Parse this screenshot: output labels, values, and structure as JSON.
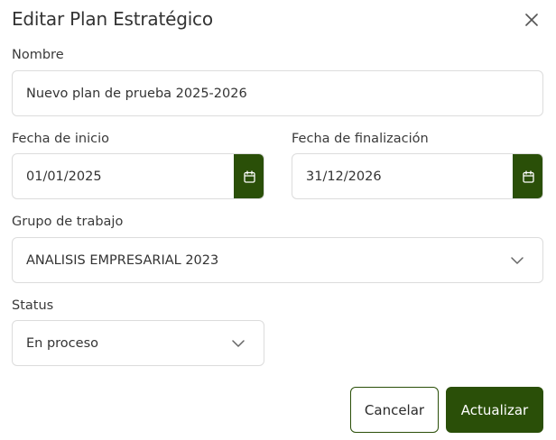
{
  "dialog": {
    "title": "Editar Plan Estratégico"
  },
  "form": {
    "name": {
      "label": "Nombre",
      "value": "Nuevo plan de prueba 2025-2026"
    },
    "start_date": {
      "label": "Fecha de inicio",
      "value": "01/01/2025"
    },
    "end_date": {
      "label": "Fecha de finalización",
      "value": "31/12/2026"
    },
    "work_group": {
      "label": "Grupo de trabajo",
      "value": "ANALISIS EMPRESARIAL 2023"
    },
    "status": {
      "label": "Status",
      "value": "En proceso"
    }
  },
  "actions": {
    "cancel_label": "Cancelar",
    "update_label": "Actualizar"
  },
  "colors": {
    "primary": "#2a4f08",
    "border": "#dcdcdc",
    "text": "#333333"
  },
  "icons": {
    "close": "close-icon",
    "calendar": "calendar-icon",
    "dropdown": "chevron-down-icon"
  }
}
